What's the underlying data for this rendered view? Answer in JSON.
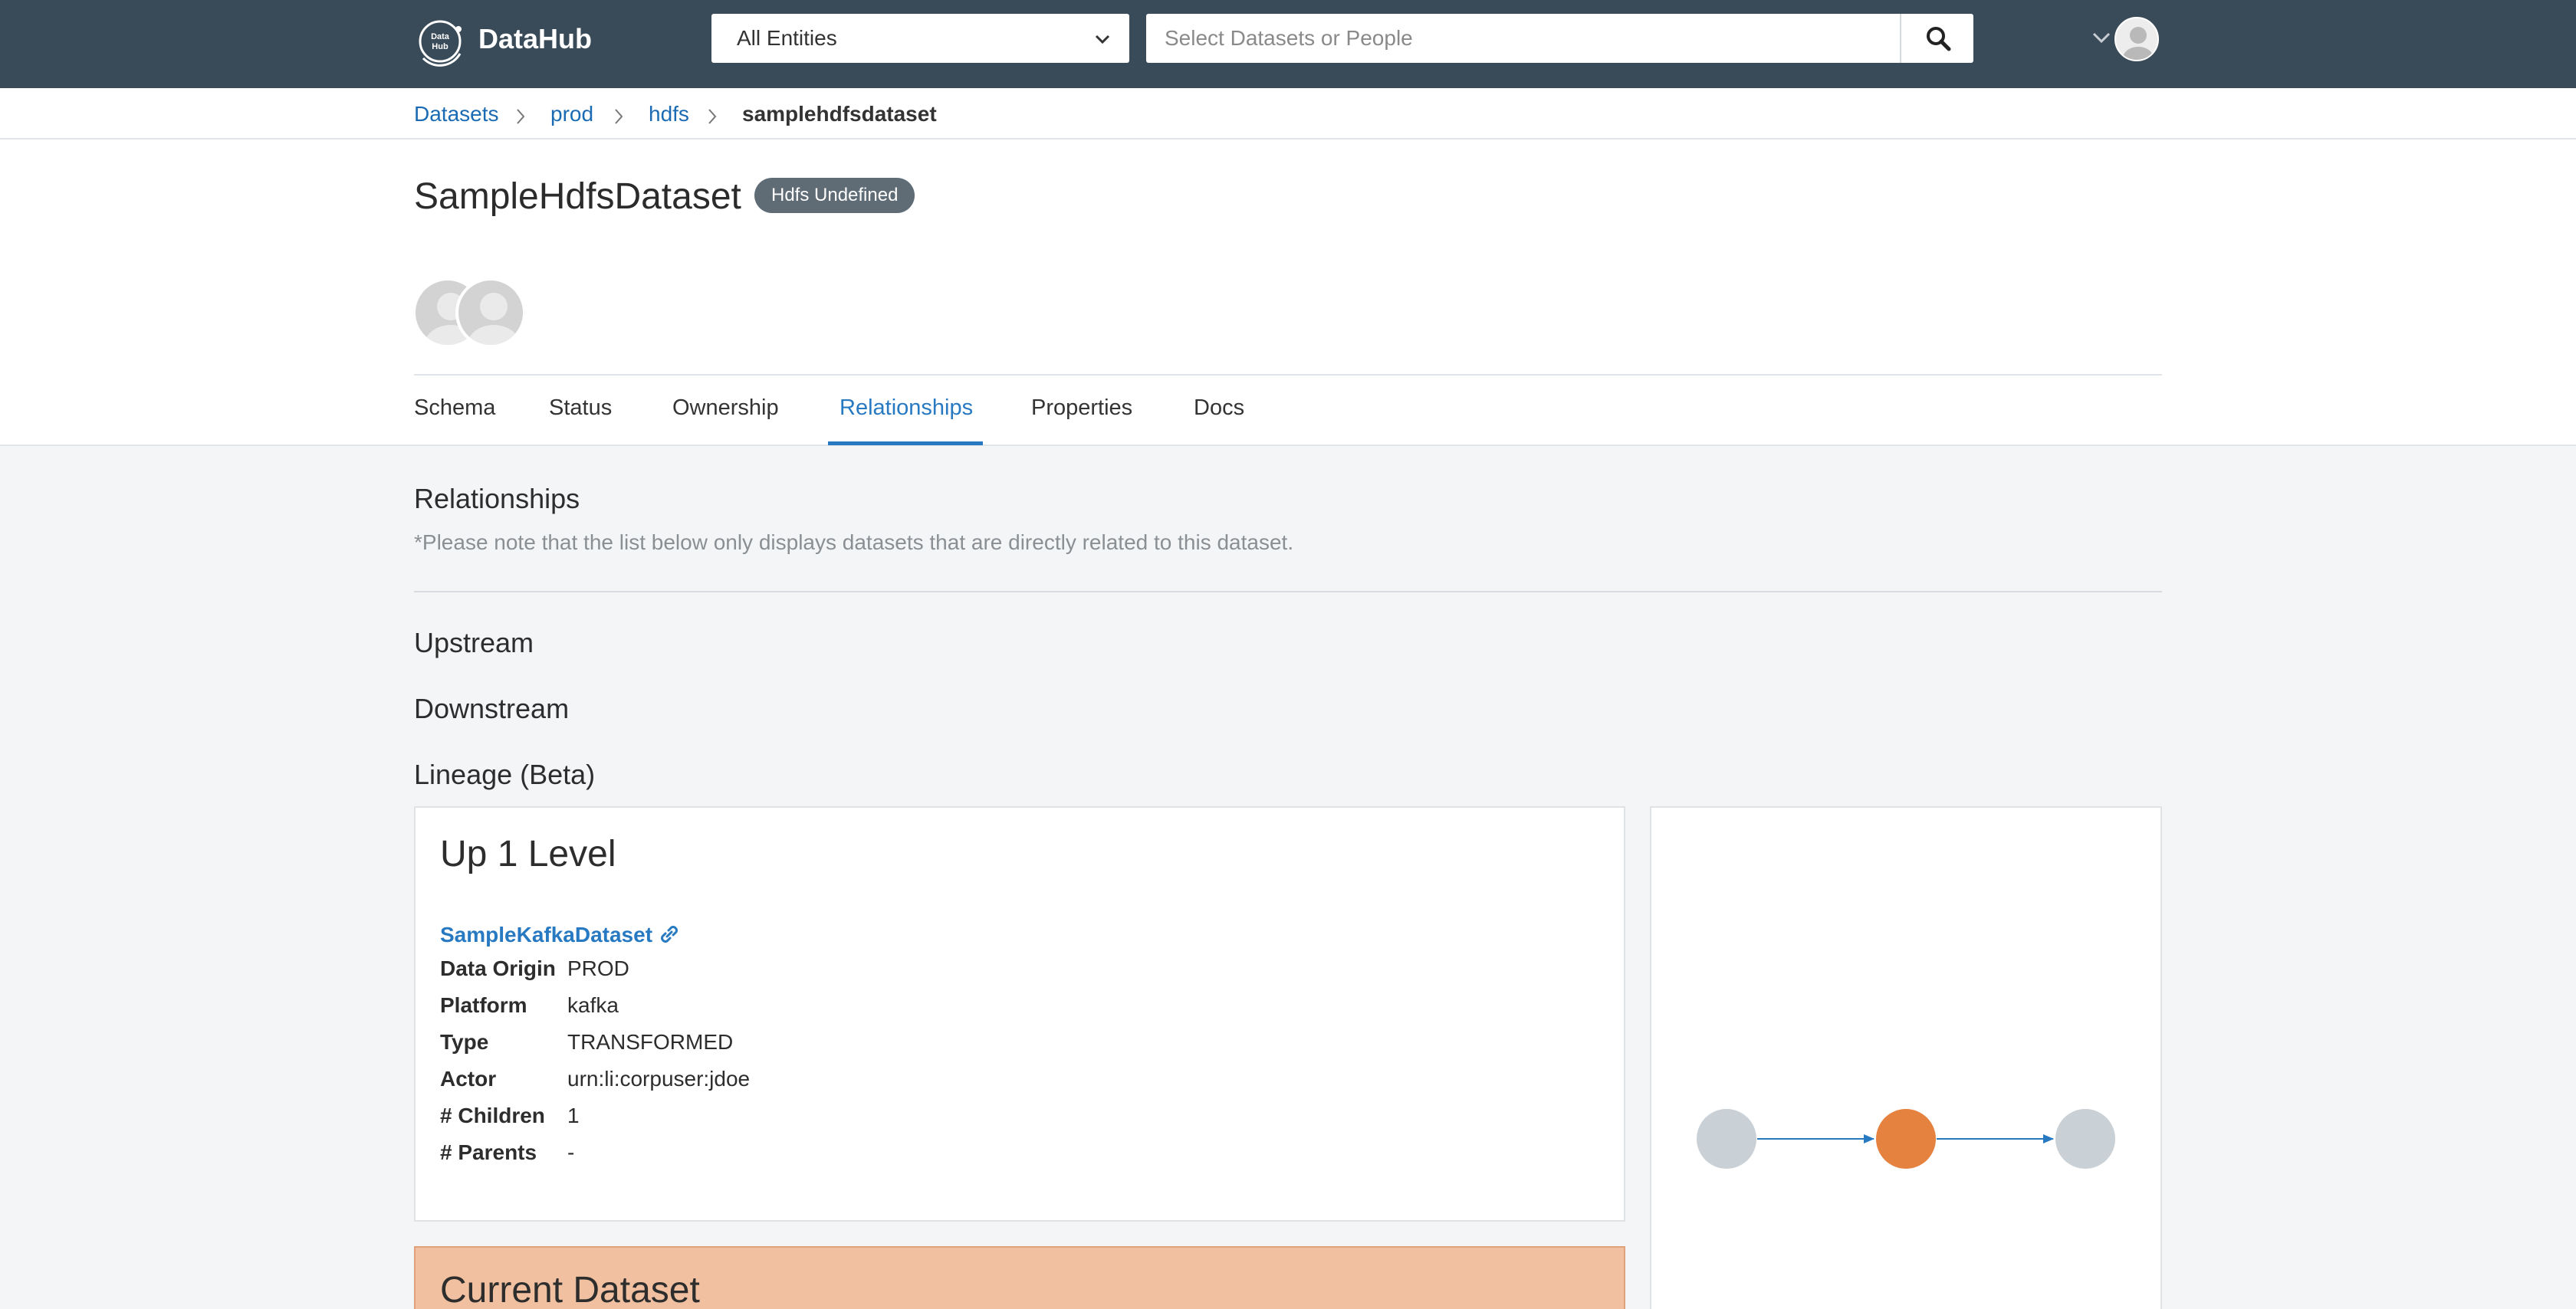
{
  "nav": {
    "brand": "DataHub",
    "entity_select": "All Entities",
    "search_placeholder": "Select Datasets or People"
  },
  "breadcrumb": [
    "Datasets",
    "prod",
    "hdfs",
    "samplehdfsdataset"
  ],
  "dataset": {
    "title": "SampleHdfsDataset",
    "platform_badge": "Hdfs Undefined"
  },
  "tabs": [
    {
      "label": "Schema",
      "active": false
    },
    {
      "label": "Status",
      "active": false
    },
    {
      "label": "Ownership",
      "active": false
    },
    {
      "label": "Relationships",
      "active": true
    },
    {
      "label": "Properties",
      "active": false
    },
    {
      "label": "Docs",
      "active": false
    }
  ],
  "relationships": {
    "heading": "Relationships",
    "note": "*Please note that the list below only displays datasets that are directly related to this dataset.",
    "upstream": "Upstream",
    "downstream": "Downstream",
    "lineage": "Lineage (Beta)"
  },
  "up_level": {
    "title": "Up 1 Level",
    "dataset_link": "SampleKafkaDataset",
    "props": [
      {
        "key": "Data Origin",
        "value": "PROD"
      },
      {
        "key": "Platform",
        "value": "kafka"
      },
      {
        "key": "Type",
        "value": "TRANSFORMED"
      },
      {
        "key": "Actor",
        "value": "urn:li:corpuser:jdoe"
      },
      {
        "key": "# Children",
        "value": "1"
      },
      {
        "key": "# Parents",
        "value": "-"
      }
    ]
  },
  "current": {
    "title": "Current Dataset"
  },
  "colors": {
    "nav_bg": "#394b58",
    "link": "#2779c2",
    "current_node": "#e5823f",
    "other_node": "#c9d0d6",
    "current_card_bg": "#f0c0a0"
  }
}
